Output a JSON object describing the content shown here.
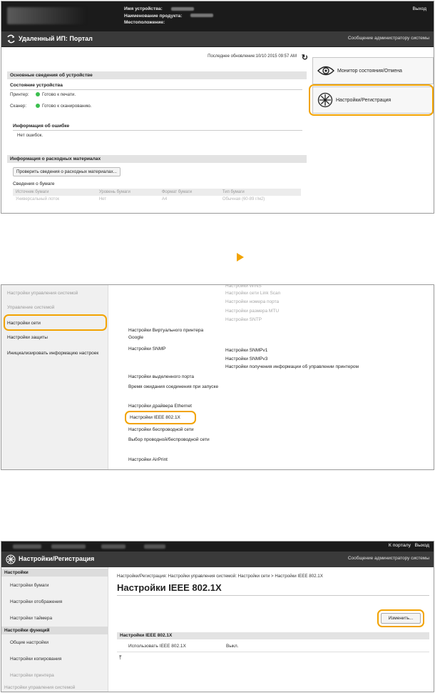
{
  "panel1": {
    "device_info": {
      "device_name_label": "Имя устройства:",
      "product_name_label": "Наименование продукта:",
      "location_label": "Местоположение:"
    },
    "logout": "Выход",
    "title": "Удаленный ИП: Портал",
    "admin_message": "Сообщение администратору системы",
    "last_update": "Последнее обновление:10/10 2015 09:57 AM",
    "basic_info": {
      "header": "Основные сведения об устройстве",
      "status_header": "Состояние устройства",
      "printer_label": "Принтер:",
      "printer_status": "Готово к печати.",
      "scanner_label": "Сканер:",
      "scanner_status": "Готово к сканированию.",
      "error_header": "Информация об ошибке",
      "error_text": "Нет ошибок."
    },
    "consumables": {
      "header": "Информация о расходных материалах",
      "check_button": "Проверить сведения о расходных материалах...",
      "paper_header": "Сведения о бумаге",
      "columns": [
        "Источник бумаги",
        "Уровень бумаги",
        "Формат бумаги",
        "Тип бумаги"
      ],
      "rows": [
        [
          "Универсальный лоток",
          "Нет",
          "A4",
          "Обычная (60-89 г/м2)"
        ]
      ]
    },
    "side_buttons": {
      "monitor": "Монитор состояния/Отмена",
      "settings": "Настройки/Регистрация"
    }
  },
  "panel2": {
    "sidebar_header": "Настройки управления системой",
    "sidebar_items": [
      "Управление системой",
      "Настройки сети",
      "Настройки защиты",
      "Инициализировать информацию настроек"
    ],
    "left_links": [
      "Настройки Виртуального принтера Google",
      "Настройки SNMP",
      "Настройки выделенного порта",
      "Время ожидания соединения при запуске",
      "Настройки драйвера Ethernet",
      "Настройки IEEE 802.1X",
      "Настройки беспроводной сети",
      "Выбор проводной/беспроводной сети",
      "Настройки AirPrint"
    ],
    "right_links": [
      "Настройки WINS",
      "Настройки сети Link Scan",
      "Настройки номера порта",
      "Настройки размера MTU",
      "Настройки SNTP",
      "Настройки SNMPv1",
      "Настройки SNMPv3",
      "Настройки получения информации об управлении принтером"
    ]
  },
  "panel3": {
    "top_links": {
      "portal": "К порталу",
      "logout": "Выход"
    },
    "title": "Настройки/Регистрация",
    "admin_message": "Сообщение администратору системы",
    "sidebar": {
      "group1": "Настройки",
      "group1_items": [
        "Настройки бумаги",
        "Настройки отображения",
        "Настройки таймера"
      ],
      "group2": "Настройки функций",
      "group2_items": [
        "Общие настройки",
        "Настройки копирования",
        "Настройки принтера",
        "Настройки управления системой"
      ]
    },
    "breadcrumb": "Настройки/Регистрация: Настройки управления системой: Настройки сети > Настройки IEEE 802.1X",
    "page_title": "Настройки IEEE 802.1X",
    "edit_button": "Изменить...",
    "section_header": "Настройки IEEE 802.1X",
    "row_label": "Использовать IEEE 802.1X",
    "row_value": "Выкл."
  },
  "colors": {
    "highlight": "#f2a300",
    "status_ok": "#3bbf4f",
    "header_dark": "#1b1b1b",
    "title_bar": "#3a3a3a"
  }
}
